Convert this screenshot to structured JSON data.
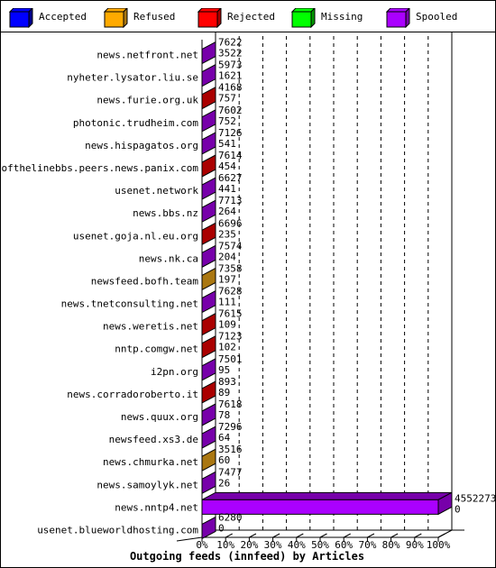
{
  "legend": [
    {
      "label": "Accepted",
      "color": "#0000ff",
      "side": "#00008b"
    },
    {
      "label": "Refused",
      "color": "#ffaa00",
      "side": "#aa7711"
    },
    {
      "label": "Rejected",
      "color": "#ff0000",
      "side": "#aa0000"
    },
    {
      "label": "Missing",
      "color": "#00ff00",
      "side": "#009900"
    },
    {
      "label": "Spooled",
      "color": "#aa00ff",
      "side": "#7700aa"
    }
  ],
  "chart_data": {
    "type": "bar",
    "orientation": "horizontal",
    "style": "3d",
    "title": "Outgoing feeds (innfeed) by Articles",
    "xlabel": "",
    "ylabel": "",
    "xlim": [
      0,
      100
    ],
    "x_unit": "%",
    "x_ticks": [
      "0%",
      "10%",
      "20%",
      "30%",
      "40%",
      "50%",
      "60%",
      "70%",
      "80%",
      "90%",
      "100%"
    ],
    "grid": true,
    "legend_position": "top",
    "categories": [
      "news.netfront.net",
      "nyheter.lysator.liu.se",
      "news.furie.org.uk",
      "photonic.trudheim.com",
      "news.hispagatos.org",
      "endofthelinebbs.peers.news.panix.com",
      "usenet.network",
      "news.bbs.nz",
      "usenet.goja.nl.eu.org",
      "news.nk.ca",
      "newsfeed.bofh.team",
      "news.tnetconsulting.net",
      "news.weretis.net",
      "nntp.comgw.net",
      "i2pn.org",
      "news.corradoroberto.it",
      "news.quux.org",
      "newsfeed.xs3.de",
      "news.chmurka.net",
      "news.samoylyk.net",
      "news.nntp4.net",
      "usenet.blueworldhosting.com"
    ],
    "top_labels": [
      "7622",
      "5973",
      "4168",
      "7602",
      "7126",
      "7614",
      "6627",
      "7713",
      "6696",
      "7574",
      "7358",
      "7628",
      "7615",
      "7123",
      "7501",
      "893",
      "7618",
      "7296",
      "3516",
      "7477",
      "4552273",
      "6280"
    ],
    "bottom_labels": [
      "3522",
      "1621",
      "757",
      "752",
      "541",
      "454",
      "441",
      "264",
      "235",
      "204",
      "197",
      "111",
      "109",
      "102",
      "95",
      "89",
      "78",
      "64",
      "60",
      "26",
      "0",
      "0"
    ],
    "bar_series": [
      "Spooled",
      "Spooled",
      "Rejected",
      "Spooled",
      "Spooled",
      "Rejected",
      "Spooled",
      "Spooled",
      "Rejected",
      "Spooled",
      "Refused",
      "Spooled",
      "Rejected",
      "Rejected",
      "Spooled",
      "Rejected",
      "Spooled",
      "Spooled",
      "Refused",
      "Spooled",
      "Spooled",
      "Spooled"
    ],
    "values_percent": [
      0.3,
      0.3,
      0.3,
      0.3,
      0.3,
      0.3,
      0.3,
      0.3,
      0.3,
      0.3,
      0.3,
      0.3,
      0.3,
      0.3,
      0.3,
      0.3,
      0.3,
      0.3,
      0.3,
      0.3,
      100,
      0.3
    ]
  }
}
